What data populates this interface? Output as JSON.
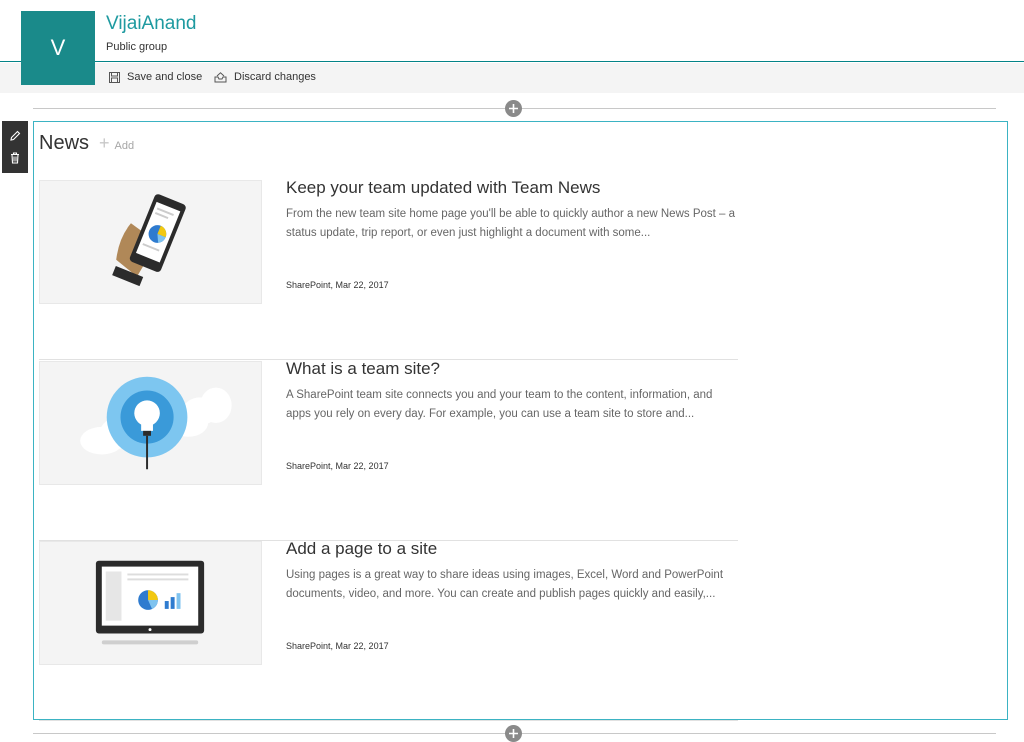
{
  "site": {
    "logo_letter": "V",
    "title": "VijaiAnand",
    "subtitle": "Public group"
  },
  "toolbar": {
    "save_label": "Save and close",
    "discard_label": "Discard changes"
  },
  "news": {
    "title": "News",
    "add_label": "Add",
    "items": [
      {
        "title": "Keep your team updated with Team News",
        "description": "From the new team site home page you'll be able to quickly author a new News Post – a status update, trip report, or even just highlight a document with some...",
        "author": "SharePoint",
        "date": "Mar 22, 2017",
        "thumbnail_icon": "phone-chart-illustration"
      },
      {
        "title": "What is a team site?",
        "description": "A SharePoint team site connects you and your team to the content, information, and apps you rely on every day. For example, you can use a team site to store and...",
        "author": "SharePoint",
        "date": "Mar 22, 2017",
        "thumbnail_icon": "lightbulb-cloud-illustration"
      },
      {
        "title": "Add a page to a site",
        "description": "Using pages is a great way to share ideas using images, Excel, Word and PowerPoint documents, video, and more. You can create and publish pages quickly and easily,...",
        "author": "SharePoint",
        "date": "Mar 22, 2017",
        "thumbnail_icon": "tablet-chart-illustration"
      }
    ]
  },
  "colors": {
    "brand": "#1a8a8a",
    "title_teal": "#1e9aa0",
    "webpart_border": "#3bb3c3"
  }
}
